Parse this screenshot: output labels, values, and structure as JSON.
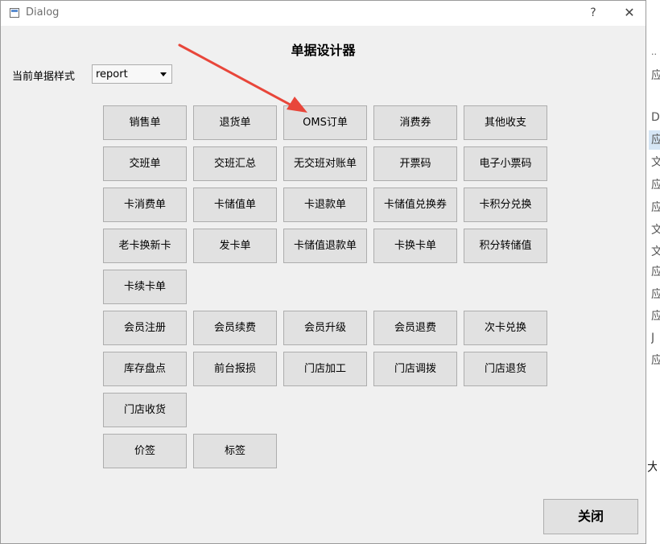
{
  "background_app": {
    "glyphs": [
      "应",
      "D",
      "应",
      "文",
      "应",
      "应",
      "文",
      "文",
      "应",
      "应",
      "应",
      "J",
      "应"
    ],
    "side_char": "大"
  },
  "dialog": {
    "title": "Dialog",
    "help_label": "?",
    "close_label": "✕",
    "heading": "单据设计器",
    "style_label": "当前单据样式",
    "style_value": "report",
    "close_button": "关闭"
  },
  "buttons": {
    "r1": [
      "销售单",
      "退货单",
      "OMS订单",
      "消费券",
      "其他收支"
    ],
    "r2": [
      "交班单",
      "交班汇总",
      "无交班对账单",
      "开票码",
      "电子小票码"
    ],
    "r3": [
      "卡消费单",
      "卡储值单",
      "卡退款单",
      "卡储值兑换券",
      "卡积分兑换"
    ],
    "r4": [
      "老卡换新卡",
      "发卡单",
      "卡储值退款单",
      "卡换卡单",
      "积分转储值"
    ],
    "r5": [
      "卡续卡单"
    ],
    "r6": [
      "会员注册",
      "会员续费",
      "会员升级",
      "会员退费",
      "次卡兑换"
    ],
    "r7": [
      "库存盘点",
      "前台报损",
      "门店加工",
      "门店调拨",
      "门店退货"
    ],
    "r8": [
      "门店收货"
    ],
    "r9": [
      "价签",
      "标签"
    ]
  },
  "colors": {
    "arrow": "#e8463a",
    "button_bg": "#e1e1e1",
    "dialog_bg": "#f0f0f0"
  }
}
